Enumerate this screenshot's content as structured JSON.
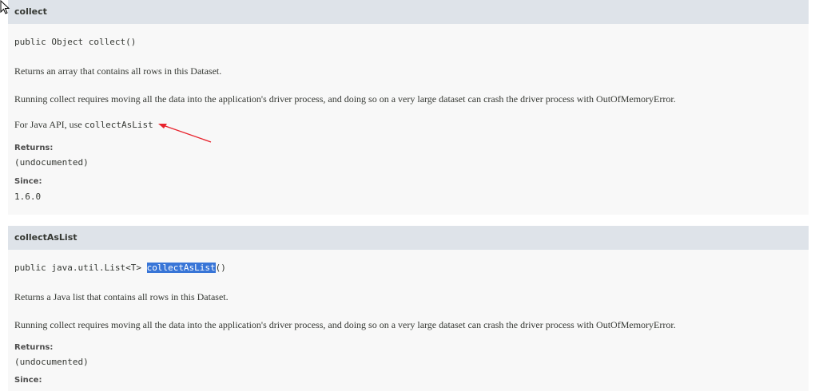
{
  "collect": {
    "title": "collect",
    "signature": "public Object collect()",
    "description": "Returns an array that contains all rows in this Dataset.",
    "note": "Running collect requires moving all the data into the application's driver process, and doing so on a very large dataset can crash the driver process with OutOfMemoryError.",
    "java_api_prefix": "For Java API, use ",
    "java_api_code": "collectAsList",
    "returns_label": "Returns:",
    "returns_value": "(undocumented)",
    "since_label": "Since:",
    "since_value": "1.6.0"
  },
  "collectAsList": {
    "title": "collectAsList",
    "signature_prefix": "public java.util.List<T> ",
    "signature_name": "collectAsList",
    "signature_suffix": "()",
    "description": "Returns a Java list that contains all rows in this Dataset.",
    "note": "Running collect requires moving all the data into the application's driver process, and doing so on a very large dataset can crash the driver process with OutOfMemoryError.",
    "returns_label": "Returns:",
    "returns_value": "(undocumented)",
    "since_label": "Since:"
  },
  "colors": {
    "header_bg": "#dee3e9",
    "section_bg": "#f8f8f8",
    "highlight": "#3875d7",
    "annotation_arrow": "#e8232d"
  },
  "icons": [
    "mouse-pointer-icon",
    "annotation-arrow"
  ]
}
